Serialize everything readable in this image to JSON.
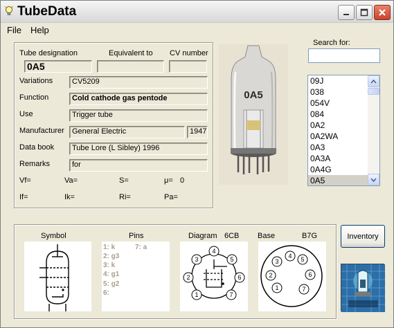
{
  "window": {
    "title": "TubeData"
  },
  "menu": {
    "file": "File",
    "help": "Help"
  },
  "details": {
    "tube_designation_label": "Tube designation",
    "equivalent_label": "Equivalent to",
    "cv_label": "CV number",
    "tube_designation": "0A5",
    "equivalent": "",
    "cv_number": "",
    "variations_label": "Variations",
    "variations": "CV5209",
    "function_label": "Function",
    "function": "Cold cathode gas pentode",
    "use_label": "Use",
    "use": "Trigger tube",
    "manufacturer_label": "Manufacturer",
    "manufacturer": "General Electric",
    "year": "1947",
    "databook_label": "Data book",
    "databook": "Tube Lore (L Sibley) 1996",
    "remarks_label": "Remarks",
    "remarks": "for",
    "params": {
      "vf": "Vf=",
      "va": "Va=",
      "s": "S=",
      "mu": "μ=",
      "mu_value": "0",
      "if": "If=",
      "ik": "Ik=",
      "ri": "Ri=",
      "pa": "Pa="
    }
  },
  "photo": {
    "marking": "0A5"
  },
  "search": {
    "label": "Search for:",
    "value": ""
  },
  "tube_list": [
    "09J",
    "038",
    "054V",
    "084",
    "0A2",
    "0A2WA",
    "0A3",
    "0A3A",
    "0A4G",
    "0A5"
  ],
  "tube_list_selected": "0A5",
  "bottom": {
    "symbol_label": "Symbol",
    "pins_label": "Pins",
    "diagram_label": "Diagram",
    "diagram_code": "6CB",
    "base_label": "Base",
    "base_code": "B7G",
    "pins": [
      "1: k",
      "7: a",
      "2: g3",
      "3: k",
      "4: g1",
      "5: g2",
      "6:"
    ],
    "diagram_numbers": [
      "1",
      "2",
      "3",
      "4",
      "5",
      "6",
      "7"
    ],
    "base_numbers": [
      "1",
      "2",
      "3",
      "4",
      "5",
      "6",
      "7"
    ]
  },
  "buttons": {
    "inventory": "Inventory"
  }
}
